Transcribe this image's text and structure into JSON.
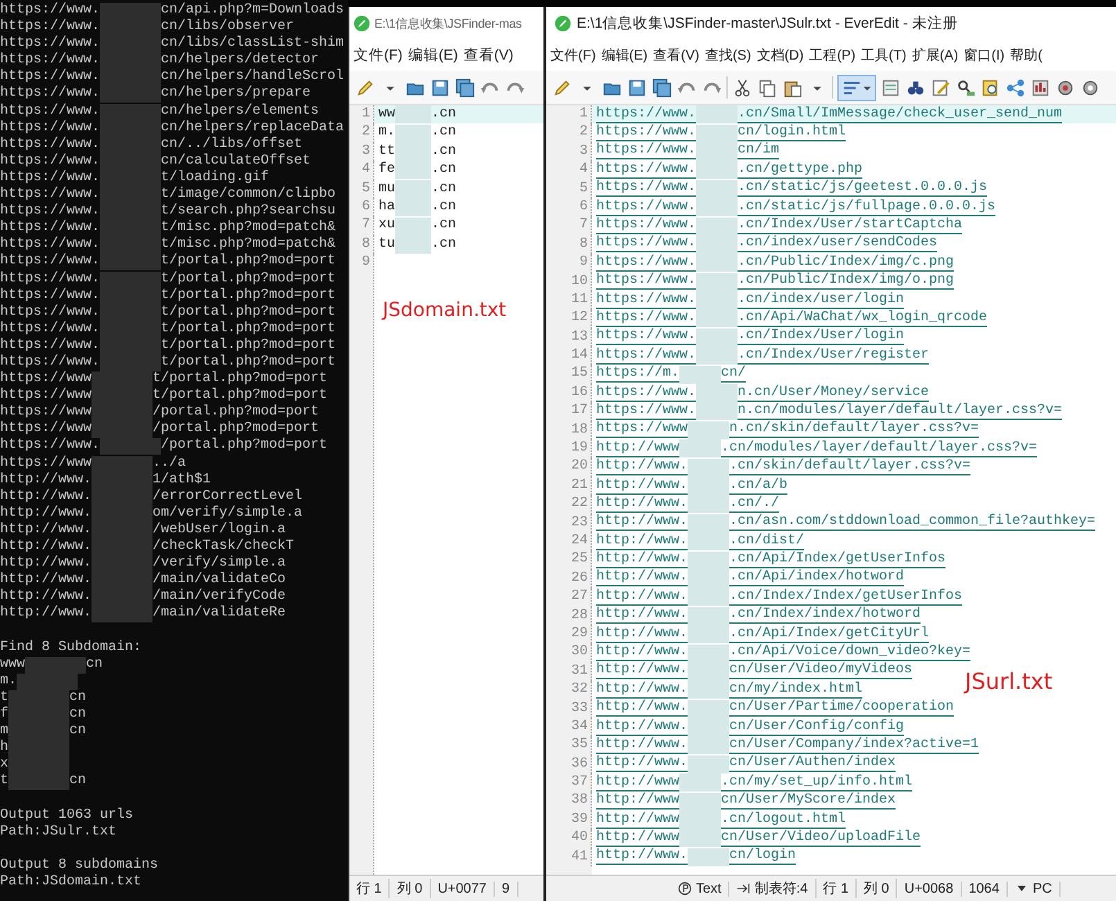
{
  "terminal": {
    "lines": [
      {
        "kind": "url",
        "head": "https://www.",
        "tail": "cn/api.php?m=Downloads"
      },
      {
        "kind": "url",
        "head": "https://www.",
        "tail": "cn/libs/observer"
      },
      {
        "kind": "url",
        "head": "https://www.",
        "tail": "cn/libs/classList-shim"
      },
      {
        "kind": "url",
        "head": "https://www.",
        "tail": "cn/helpers/detector"
      },
      {
        "kind": "url",
        "head": "https://www.",
        "tail": "cn/helpers/handleScrol"
      },
      {
        "kind": "url",
        "head": "https://www.",
        "tail": "cn/helpers/prepare"
      },
      {
        "kind": "url",
        "head": "https://www.",
        "tail": "cn/helpers/elements"
      },
      {
        "kind": "url",
        "head": "https://www.",
        "tail": "cn/helpers/replaceData"
      },
      {
        "kind": "url",
        "head": "https://www.",
        "tail": "cn/../libs/offset"
      },
      {
        "kind": "url",
        "head": "https://www.",
        "tail": "cn/calculateOffset"
      },
      {
        "kind": "url",
        "head": "https://www.",
        "tail": "t/loading.gif"
      },
      {
        "kind": "url",
        "head": "https://www.",
        "tail": "t/image/common/clipbo"
      },
      {
        "kind": "url",
        "head": "https://www.",
        "tail": "t/search.php?searchsu"
      },
      {
        "kind": "url",
        "head": "https://www.",
        "tail": "t/misc.php?mod=patch&"
      },
      {
        "kind": "url",
        "head": "https://www.",
        "tail": "t/misc.php?mod=patch&"
      },
      {
        "kind": "url",
        "head": "https://www.",
        "tail": "t/portal.php?mod=port"
      },
      {
        "kind": "url",
        "head": "https://www.",
        "tail": "t/portal.php?mod=port"
      },
      {
        "kind": "url",
        "head": "https://www.",
        "tail": "t/portal.php?mod=port"
      },
      {
        "kind": "url",
        "head": "https://www.",
        "tail": "t/portal.php?mod=port"
      },
      {
        "kind": "url",
        "head": "https://www.",
        "tail": "t/portal.php?mod=port"
      },
      {
        "kind": "url",
        "head": "https://www.",
        "tail": "t/portal.php?mod=port"
      },
      {
        "kind": "url",
        "head": "https://www.",
        "tail": "t/portal.php?mod=port"
      },
      {
        "kind": "url",
        "head": "https://www",
        "tail": "t/portal.php?mod=port"
      },
      {
        "kind": "url",
        "head": "https://www",
        "tail": "t/portal.php?mod=port"
      },
      {
        "kind": "url",
        "head": "https://www",
        "tail": "/portal.php?mod=port"
      },
      {
        "kind": "url",
        "head": "https://www",
        "tail": "/portal.php?mod=port"
      },
      {
        "kind": "url",
        "head": "https://www.",
        "tail": "/portal.php?mod=port"
      },
      {
        "kind": "url",
        "head": "https://www",
        "tail": "../a"
      },
      {
        "kind": "url",
        "head": "http://www.",
        "tail": "1/ath$1"
      },
      {
        "kind": "url",
        "head": "http://www.",
        "tail": "/errorCorrectLevel"
      },
      {
        "kind": "url",
        "head": "http://www.",
        "tail": "om/verify/simple.a"
      },
      {
        "kind": "url",
        "head": "http://www.",
        "tail": "/webUser/login.a"
      },
      {
        "kind": "url",
        "head": "http://www.",
        "tail": "/checkTask/checkT"
      },
      {
        "kind": "url",
        "head": "http://www.",
        "tail": "/verify/simple.a"
      },
      {
        "kind": "url",
        "head": "http://www.",
        "tail": "/main/validateCo"
      },
      {
        "kind": "url",
        "head": "http://www.",
        "tail": "/main/verifyCode"
      },
      {
        "kind": "url",
        "head": "http://www.",
        "tail": "/main/validateRe"
      },
      {
        "kind": "blank"
      },
      {
        "kind": "text",
        "text": "Find 8 Subdomain:"
      },
      {
        "kind": "url",
        "head": "www",
        "tail": "cn"
      },
      {
        "kind": "url",
        "head": "m."
      },
      {
        "kind": "url",
        "head": "t",
        "tail": "cn"
      },
      {
        "kind": "url",
        "head": "f",
        "tail": "cn"
      },
      {
        "kind": "url",
        "head": "m",
        "tail": "cn"
      },
      {
        "kind": "url",
        "head": "h"
      },
      {
        "kind": "url",
        "head": "x"
      },
      {
        "kind": "url",
        "head": "t",
        "tail": "cn"
      },
      {
        "kind": "blank"
      },
      {
        "kind": "text",
        "text": "Output 1063 urls"
      },
      {
        "kind": "text",
        "text": "Path:JSulr.txt"
      },
      {
        "kind": "blank"
      },
      {
        "kind": "text",
        "text": "Output 8 subdomains"
      },
      {
        "kind": "text",
        "text": "Path:JSdomain.txt"
      }
    ]
  },
  "domain_window": {
    "title": "E:\\1信息收集\\JSFinder-mas",
    "menu": [
      "文件(F)",
      "编辑(E)",
      "查看(V)"
    ],
    "lines": [
      {
        "number": "1",
        "head": "ww",
        "tail": ".cn",
        "current": true
      },
      {
        "number": "2",
        "head": "m.",
        "tail": ".cn",
        "current": false
      },
      {
        "number": "3",
        "head": "tt",
        "tail": ".cn",
        "current": false
      },
      {
        "number": "4",
        "head": "fe",
        "tail": ".cn",
        "current": false
      },
      {
        "number": "5",
        "head": "mu",
        "tail": ".cn",
        "current": false
      },
      {
        "number": "6",
        "head": "ha",
        "tail": ".cn",
        "current": false
      },
      {
        "number": "7",
        "head": "xu",
        "tail": ".cn",
        "current": false
      },
      {
        "number": "8",
        "head": "tu",
        "tail": ".cn",
        "current": false
      },
      {
        "number": "9",
        "current": false
      }
    ],
    "annotation": "JSdomain.txt",
    "status": [
      {
        "kind": "plain",
        "text": "行 1"
      },
      {
        "kind": "plain",
        "text": "列 0"
      },
      {
        "kind": "plain",
        "text": "U+0077"
      },
      {
        "kind": "plain",
        "text": "9"
      }
    ]
  },
  "url_window": {
    "title": "E:\\1信息收集\\JSFinder-master\\JSulr.txt - EverEdit - 未注册",
    "menu": [
      "文件(F)",
      "编辑(E)",
      "查看(V)",
      "查找(S)",
      "文档(D)",
      "工程(P)",
      "工具(T)",
      "扩展(A)",
      "窗口(I)",
      "帮助("
    ],
    "toolbar": {
      "wrap_pressed": true
    },
    "lines": [
      {
        "number": "1",
        "head": "https://www.",
        "tail": ".cn/Small/ImMessage/check_user_send_num",
        "current": true
      },
      {
        "number": "2",
        "head": "https://www.",
        "tail": "cn/login.html",
        "current": false
      },
      {
        "number": "3",
        "head": "https://www.",
        "tail": "cn/im",
        "current": false
      },
      {
        "number": "4",
        "head": "https://www.",
        "tail": ".cn/gettype.php",
        "current": false
      },
      {
        "number": "5",
        "head": "https://www.",
        "tail": ".cn/static/js/geetest.0.0.0.js",
        "current": false
      },
      {
        "number": "6",
        "head": "https://www.",
        "tail": ".cn/static/js/fullpage.0.0.0.js",
        "current": false
      },
      {
        "number": "7",
        "head": "https://www.",
        "tail": ".cn/Index/User/startCaptcha",
        "current": false
      },
      {
        "number": "8",
        "head": "https://www.",
        "tail": ".cn/index/user/sendCodes",
        "current": false
      },
      {
        "number": "9",
        "head": "https://www.",
        "tail": ".cn/Public/Index/img/c.png",
        "current": false
      },
      {
        "number": "10",
        "head": "https://www.",
        "tail": ".cn/Public/Index/img/o.png",
        "current": false
      },
      {
        "number": "11",
        "head": "https://www.",
        "tail": ".cn/index/user/login",
        "current": false
      },
      {
        "number": "12",
        "head": "https://www.",
        "tail": ".cn/Api/WaChat/wx_login_qrcode",
        "current": false
      },
      {
        "number": "13",
        "head": "https://www.",
        "tail": ".cn/Index/User/login",
        "current": false
      },
      {
        "number": "14",
        "head": "https://www.",
        "tail": ".cn/Index/User/register",
        "current": false
      },
      {
        "number": "15",
        "head": "https://m.",
        "tail": "cn/",
        "current": false
      },
      {
        "number": "16",
        "head": "https://www.",
        "tail": "n.cn/User/Money/service",
        "current": false
      },
      {
        "number": "17",
        "head": "https://www.",
        "tail": "n.cn/modules/layer/default/layer.css?v=",
        "current": false
      },
      {
        "number": "18",
        "head": "https://www",
        "tail": "n.cn/skin/default/layer.css?v=",
        "current": false
      },
      {
        "number": "19",
        "head": "http://www",
        "tail": ".cn/modules/layer/default/layer.css?v=",
        "current": false
      },
      {
        "number": "20",
        "head": "http://www.",
        "tail": ".cn/skin/default/layer.css?v=",
        "current": false
      },
      {
        "number": "21",
        "head": "http://www.",
        "tail": ".cn/a/b",
        "current": false
      },
      {
        "number": "22",
        "head": "http://www.",
        "tail": ".cn/./",
        "current": false
      },
      {
        "number": "23",
        "head": "http://www.",
        "tail": ".cn/asn.com/stddownload_common_file?authkey=",
        "current": false
      },
      {
        "number": "24",
        "head": "http://www.",
        "tail": ".cn/dist/",
        "current": false
      },
      {
        "number": "25",
        "head": "http://www.",
        "tail": ".cn/Api/Index/getUserInfos",
        "current": false
      },
      {
        "number": "26",
        "head": "http://www.",
        "tail": ".cn/Api/index/hotword",
        "current": false
      },
      {
        "number": "27",
        "head": "http://www.",
        "tail": ".cn/Index/Index/getUserInfos",
        "current": false
      },
      {
        "number": "28",
        "head": "http://www.",
        "tail": ".cn/Index/index/hotword",
        "current": false
      },
      {
        "number": "29",
        "head": "http://www.",
        "tail": ".cn/Api/Index/getCityUrl",
        "current": false
      },
      {
        "number": "30",
        "head": "http://www.",
        "tail": ".cn/Api/Voice/down_video?key=",
        "current": false
      },
      {
        "number": "31",
        "head": "http://www.",
        "tail": "cn/User/Video/myVideos",
        "current": false
      },
      {
        "number": "32",
        "head": "http://www.",
        "tail": "cn/my/index.html",
        "current": false
      },
      {
        "number": "33",
        "head": "http://www.",
        "tail": "cn/User/Partime/cooperation",
        "current": false
      },
      {
        "number": "34",
        "head": "http://www.",
        "tail": "cn/User/Config/config",
        "current": false
      },
      {
        "number": "35",
        "head": "http://www.",
        "tail": "cn/User/Company/index?active=1",
        "current": false
      },
      {
        "number": "36",
        "head": "http://www.",
        "tail": "cn/User/Authen/index",
        "current": false
      },
      {
        "number": "37",
        "head": "http://www",
        "tail": ".cn/my/set_up/info.html",
        "current": false
      },
      {
        "number": "38",
        "head": "http://www",
        "tail": "cn/User/MyScore/index",
        "current": false
      },
      {
        "number": "39",
        "head": "http://www",
        "tail": ".cn/logout.html",
        "current": false
      },
      {
        "number": "40",
        "head": "http://www",
        "tail": "cn/User/Video/uploadFile",
        "current": false
      },
      {
        "number": "41",
        "head": "http://www.",
        "tail": "cn/login",
        "current": false
      }
    ],
    "annotation": "JSurl.txt",
    "status": [
      {
        "kind": "mode",
        "text": "Text"
      },
      {
        "kind": "tab",
        "text": "制表符:4"
      },
      {
        "kind": "plain",
        "text": "行 1"
      },
      {
        "kind": "plain",
        "text": "列 0"
      },
      {
        "kind": "plain",
        "text": "U+0068"
      },
      {
        "kind": "plain",
        "text": "1064"
      },
      {
        "kind": "dropdown",
        "text": "PC"
      }
    ]
  }
}
